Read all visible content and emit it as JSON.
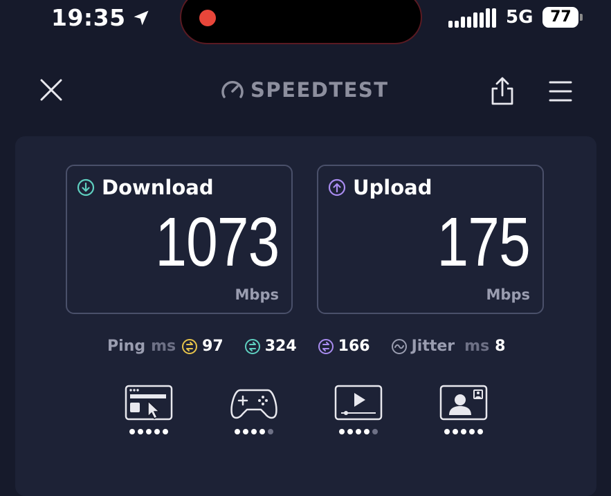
{
  "status_bar": {
    "time": "19:35",
    "network": "5G",
    "battery": "77",
    "battery_level": 0.77
  },
  "header": {
    "brand": "SPEEDTEST",
    "icons": [
      "close-icon",
      "speedometer-icon",
      "share-icon",
      "menu-icon"
    ]
  },
  "results": {
    "download": {
      "label": "Download",
      "value": "1073",
      "unit": "Mbps",
      "color": "#5fd0c0"
    },
    "upload": {
      "label": "Upload",
      "value": "175",
      "unit": "Mbps",
      "color": "#a98cf0"
    }
  },
  "latency": {
    "ping_label": "Ping",
    "ping_unit": "ms",
    "idle": "97",
    "download": "324",
    "upload": "166",
    "jitter_label": "Jitter",
    "jitter_unit": "ms",
    "jitter": "8",
    "colors": {
      "idle": "#e6c34a",
      "download": "#5fd0c0",
      "upload": "#a98cf0",
      "jitter": "#9a9db0"
    }
  },
  "experience": [
    {
      "icon": "web-browsing-icon",
      "rating": 5,
      "max": 5
    },
    {
      "icon": "gaming-icon",
      "rating": 4,
      "max": 5
    },
    {
      "icon": "video-streaming-icon",
      "rating": 4,
      "max": 5
    },
    {
      "icon": "video-call-icon",
      "rating": 5,
      "max": 5
    }
  ]
}
